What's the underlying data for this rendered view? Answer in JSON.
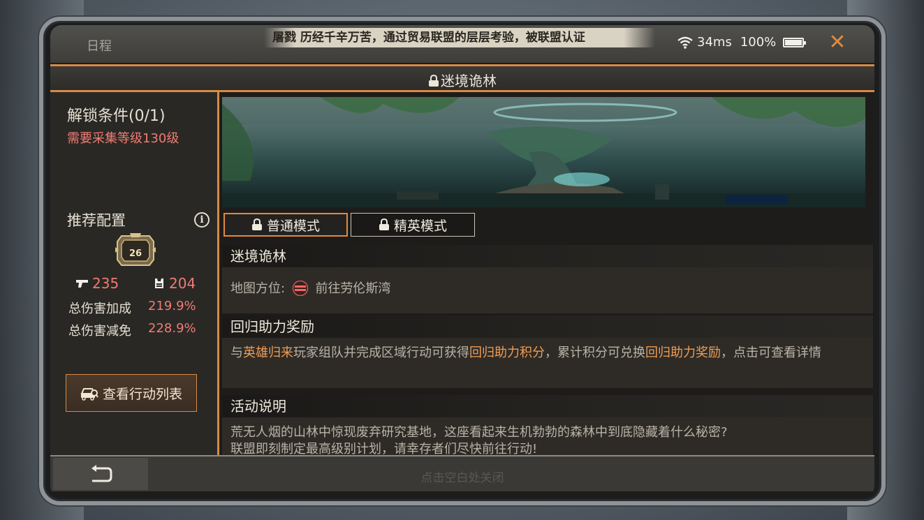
{
  "topbar": {
    "schedule_label": "日程",
    "marquee_text": "屠戮 历经千辛万苦，通过贸易联盟的层层考验，被联盟认证",
    "ping": "34ms",
    "battery_percent": "100%"
  },
  "title": "迷境诡林",
  "left": {
    "unlock_title": "解锁条件(0/1)",
    "unlock_requirement": "需要采集等级130级",
    "recommend_title": "推荐配置",
    "badge_level": "26",
    "attack_value": "235",
    "defense_value": "204",
    "damage_bonus_label": "总伤害加成",
    "damage_bonus_value": "219.9%",
    "damage_reduce_label": "总伤害减免",
    "damage_reduce_value": "228.9%",
    "action_list_label": "查看行动列表"
  },
  "tabs": {
    "normal": "普通模式",
    "elite": "精英模式"
  },
  "sections": {
    "dungeon_name": "迷境诡林",
    "map_location_label": "地图方位:",
    "map_location_value": "前往劳伦斯湾",
    "reward_title": "回归助力奖励",
    "reward_text_1": "与",
    "reward_hl_1": "英雄归来",
    "reward_text_2": "玩家组队并完成区域行动可获得",
    "reward_hl_2": "回归助力积分",
    "reward_text_3": "，累计积分可兑换",
    "reward_hl_3": "回归助力奖励",
    "reward_text_4": "，点击可查看详情",
    "activity_title": "活动说明",
    "activity_line_1": "荒无人烟的山林中惊现废弃研究基地，这座看起来生机勃勃的森林中到底隐藏着什么秘密?",
    "activity_line_2": "联盟即刻制定最高级别计划，请幸存者们尽快前往行动!"
  },
  "bottom": {
    "close_hint": "点击空白处关闭"
  },
  "colors": {
    "accent": "#d78a45",
    "highlight": "#ef9d55",
    "warning": "#ee7c72"
  }
}
